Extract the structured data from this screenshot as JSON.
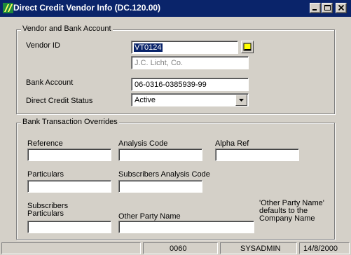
{
  "window": {
    "title": "Direct Credit Vendor Info (DC.120.00)",
    "title_bar_color": "#0a246a"
  },
  "vendor_bank": {
    "group_title": "Vendor and Bank Account",
    "vendor_id_label": "Vendor ID",
    "vendor_id_value": "VT0124",
    "vendor_name": "J.C. Licht, Co.",
    "bank_account_label": "Bank Account",
    "bank_account_value": "06-0316-0385939-99",
    "status_label": "Direct Credit Status",
    "status_value": "Active"
  },
  "overrides": {
    "group_title": "Bank Transaction Overrides",
    "reference_label": "Reference",
    "reference_value": "",
    "analysis_code_label": "Analysis Code",
    "analysis_code_value": "",
    "alpha_ref_label": "Alpha Ref",
    "alpha_ref_value": "",
    "particulars_label": "Particulars",
    "particulars_value": "",
    "subscribers_analysis_code_label": "Subscribers Analysis Code",
    "subscribers_analysis_code_value": "",
    "subscribers_particulars_label_line1": "Subscribers",
    "subscribers_particulars_label_line2": "Particulars",
    "subscribers_particulars_value": "",
    "other_party_name_label": "Other Party Name",
    "other_party_name_value": "",
    "note_line1": "'Other Party Name'",
    "note_line2": "defaults to the",
    "note_line3": "Company Name"
  },
  "status_bar": {
    "panel1": "",
    "code": "0060",
    "user": "SYSADMIN",
    "date": "14/8/2000"
  }
}
